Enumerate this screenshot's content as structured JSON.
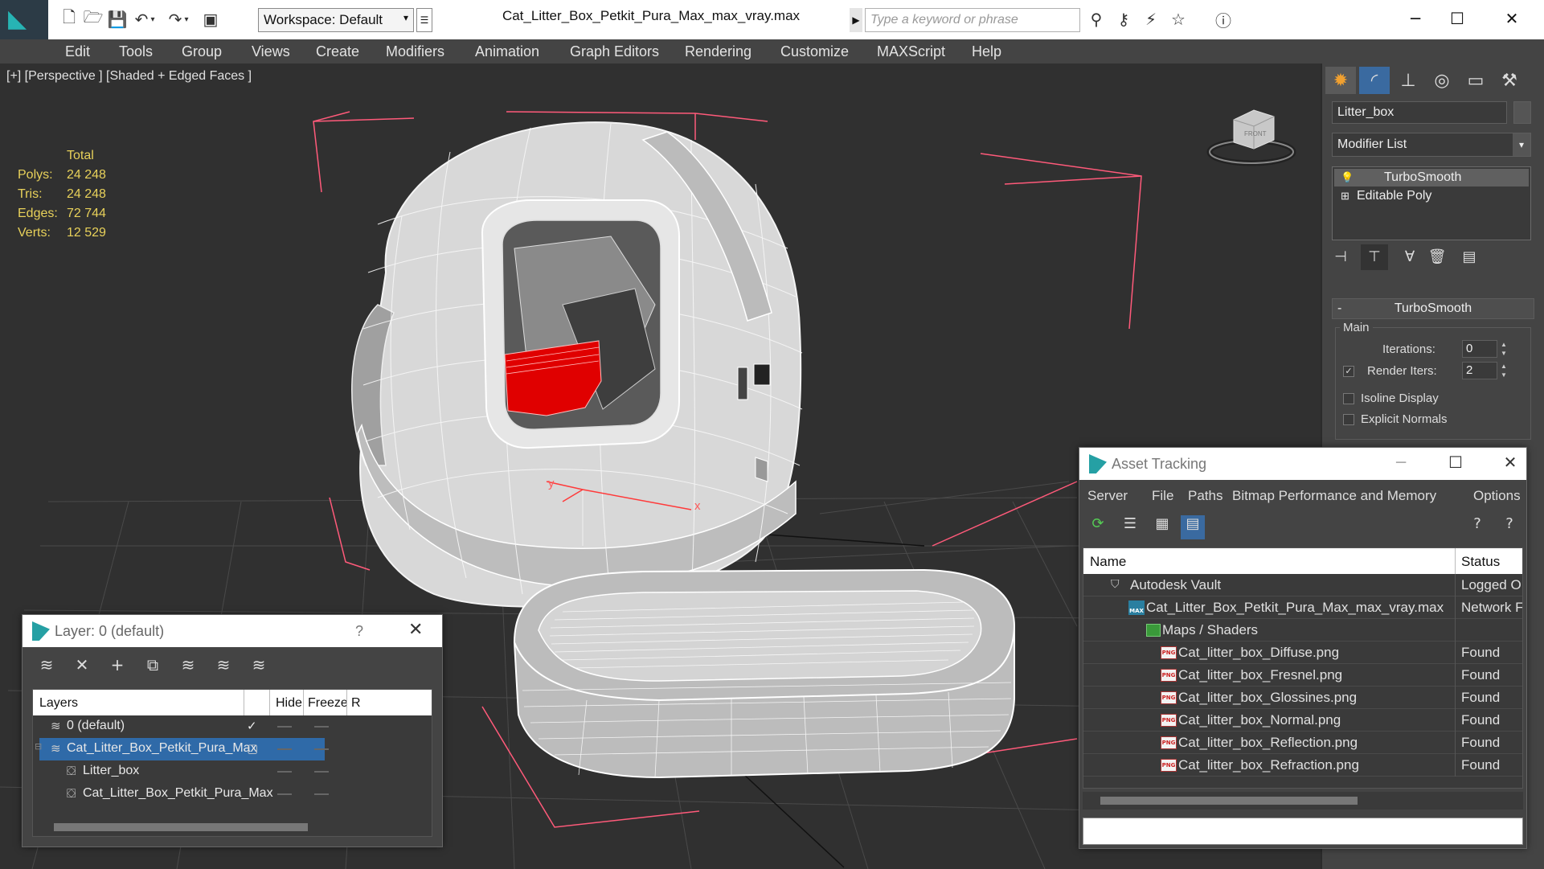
{
  "titlebar": {
    "file_title": "Cat_Litter_Box_Petkit_Pura_Max_max_vray.max",
    "workspace_label": "Workspace: Default",
    "search_placeholder": "Type a keyword or phrase",
    "quick_access_icons": [
      "new-file-icon",
      "open-file-icon",
      "save-icon",
      "undo-icon",
      "redo-icon",
      "project-icon"
    ],
    "search_tools_icons": [
      "binoculars-icon",
      "key-icon",
      "communication-icon",
      "star-icon",
      "help-icon"
    ],
    "window_controls": [
      "minimize",
      "maximize",
      "close"
    ]
  },
  "menu": [
    "Edit",
    "Tools",
    "Group",
    "Views",
    "Create",
    "Modifiers",
    "Animation",
    "Graph Editors",
    "Rendering",
    "Customize",
    "MAXScript",
    "Help"
  ],
  "viewport": {
    "label": "[+] [Perspective ] [Shaded + Edged Faces ]",
    "stats": {
      "header": "Total",
      "rows": [
        {
          "key": "Polys:",
          "value": "24 248"
        },
        {
          "key": "Tris:",
          "value": "24 248"
        },
        {
          "key": "Edges:",
          "value": "72 744"
        },
        {
          "key": "Verts:",
          "value": "12 529"
        }
      ]
    },
    "viewcube_label": "FRONT",
    "axis_labels": {
      "x": "x",
      "y": "y"
    },
    "colors": {
      "stats": "#e8d15a",
      "bbox": "#ff5a7a",
      "accent": "#ff0000",
      "wire": "#ffffff"
    }
  },
  "command_panel": {
    "object_name": "Litter_box",
    "modifier_list": "Modifier List",
    "stack": [
      "TurboSmooth",
      "Editable Poly"
    ],
    "tabs": [
      "create-icon",
      "modify-icon",
      "hierarchy-icon",
      "motion-icon",
      "display-icon",
      "utilities-icon"
    ],
    "rollout_title": "TurboSmooth",
    "group_label": "Main",
    "iterations_label": "Iterations:",
    "iterations_value": "0",
    "render_iters_label": "Render Iters:",
    "render_iters_value": "2",
    "render_iters_checked": true,
    "isoline_label": "Isoline Display",
    "explicit_normals_label": "Explicit Normals"
  },
  "asset_tracking": {
    "title": "Asset Tracking",
    "menu": [
      "Server",
      "File",
      "Paths",
      "Bitmap Performance and Memory",
      "Options"
    ],
    "columns": [
      "Name",
      "Status"
    ],
    "rows": [
      {
        "name": "Autodesk Vault",
        "status": "Logged O",
        "icon": "vault-icon",
        "level": 1
      },
      {
        "name": "Cat_Litter_Box_Petkit_Pura_Max_max_vray.max",
        "status": "Network F",
        "icon": "max-file-icon",
        "level": 2
      },
      {
        "name": "Maps / Shaders",
        "status": "",
        "icon": "maps-icon",
        "level": 3
      },
      {
        "name": "Cat_litter_box_Diffuse.png",
        "status": "Found",
        "icon": "png-icon",
        "level": 4
      },
      {
        "name": "Cat_litter_box_Fresnel.png",
        "status": "Found",
        "icon": "png-icon",
        "level": 4
      },
      {
        "name": "Cat_litter_box_Glossines.png",
        "status": "Found",
        "icon": "png-icon",
        "level": 4
      },
      {
        "name": "Cat_litter_box_Normal.png",
        "status": "Found",
        "icon": "png-icon",
        "level": 4
      },
      {
        "name": "Cat_litter_box_Reflection.png",
        "status": "Found",
        "icon": "png-icon",
        "level": 4
      },
      {
        "name": "Cat_litter_box_Refraction.png",
        "status": "Found",
        "icon": "png-icon",
        "level": 4
      }
    ],
    "png_badge": "PNG",
    "max_badge": "MAX"
  },
  "layer_dialog": {
    "title": "Layer: 0 (default)",
    "help": "?",
    "columns": [
      "Layers",
      "Hide",
      "Freeze",
      "R"
    ],
    "rows": [
      {
        "name": "0 (default)",
        "icon": "layer-stack-icon",
        "active_check": "✓"
      },
      {
        "name": "Cat_Litter_Box_Petkit_Pura_Max",
        "icon": "layer-stack-icon",
        "selected": true
      },
      {
        "name": "Litter_box",
        "icon": "object-icon"
      },
      {
        "name": "Cat_Litter_Box_Petkit_Pura_Max",
        "icon": "object-icon"
      }
    ]
  }
}
